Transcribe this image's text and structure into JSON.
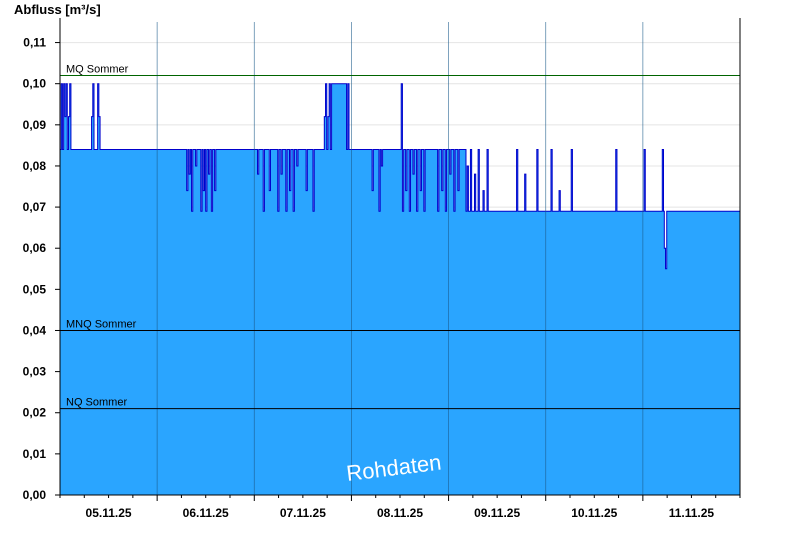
{
  "chart_data": {
    "type": "area",
    "ylabel": "Abfluss [m³/s]",
    "xlabel": "",
    "title": "",
    "ylim": [
      0,
      0.115
    ],
    "xlim": [
      "04.11.25 12:00",
      "11.11.25 12:00"
    ],
    "y_ticks": [
      "0,00",
      "0,01",
      "0,02",
      "0,03",
      "0,04",
      "0,05",
      "0,06",
      "0,07",
      "0,08",
      "0,09",
      "0,10",
      "0,11"
    ],
    "y_tick_values": [
      0,
      0.01,
      0.02,
      0.03,
      0.04,
      0.05,
      0.06,
      0.07,
      0.08,
      0.09,
      0.1,
      0.11
    ],
    "x_ticks": [
      "05.11.25",
      "06.11.25",
      "07.11.25",
      "08.11.25",
      "09.11.25",
      "10.11.25",
      "11.11.25"
    ],
    "x_tick_hours_from_start": [
      12,
      36,
      60,
      84,
      108,
      132,
      156
    ],
    "day_boundary_hours_from_start": [
      24,
      48,
      72,
      96,
      120,
      144
    ],
    "reference_lines": [
      {
        "label": "MQ Sommer",
        "value": 0.102,
        "color": "#006400"
      },
      {
        "label": "MNQ Sommer",
        "value": 0.04,
        "color": "#000000"
      },
      {
        "label": "NQ Sommer",
        "value": 0.021,
        "color": "#000000"
      }
    ],
    "fill_color": "#2aa5ff",
    "line_color": "#0000cc",
    "watermark": "Rohdaten",
    "series": [
      {
        "values_h": [
          [
            0,
            0.084
          ],
          [
            0.3,
            0.1
          ],
          [
            0.6,
            0.084
          ],
          [
            0.9,
            0.1
          ],
          [
            1.2,
            0.092
          ],
          [
            1.5,
            0.1
          ],
          [
            1.8,
            0.084
          ],
          [
            2.1,
            0.092
          ],
          [
            2.4,
            0.1
          ],
          [
            2.7,
            0.084
          ],
          [
            3.0,
            0.084
          ],
          [
            7.5,
            0.084
          ],
          [
            7.8,
            0.092
          ],
          [
            8.1,
            0.1
          ],
          [
            8.4,
            0.084
          ],
          [
            9.0,
            0.084
          ],
          [
            9.3,
            0.1
          ],
          [
            9.6,
            0.092
          ],
          [
            9.9,
            0.084
          ],
          [
            31.0,
            0.084
          ],
          [
            31.3,
            0.074
          ],
          [
            31.6,
            0.084
          ],
          [
            31.9,
            0.078
          ],
          [
            32.2,
            0.084
          ],
          [
            32.5,
            0.069
          ],
          [
            32.8,
            0.084
          ],
          [
            33.2,
            0.084
          ],
          [
            33.5,
            0.08
          ],
          [
            33.8,
            0.084
          ],
          [
            34.5,
            0.084
          ],
          [
            34.8,
            0.069
          ],
          [
            35.1,
            0.084
          ],
          [
            35.4,
            0.074
          ],
          [
            35.7,
            0.084
          ],
          [
            36.0,
            0.069
          ],
          [
            36.3,
            0.084
          ],
          [
            36.7,
            0.078
          ],
          [
            37.0,
            0.084
          ],
          [
            37.4,
            0.069
          ],
          [
            37.7,
            0.084
          ],
          [
            38.2,
            0.074
          ],
          [
            38.5,
            0.084
          ],
          [
            48.5,
            0.084
          ],
          [
            48.8,
            0.078
          ],
          [
            49.1,
            0.084
          ],
          [
            49.9,
            0.084
          ],
          [
            50.2,
            0.069
          ],
          [
            50.5,
            0.084
          ],
          [
            51.4,
            0.084
          ],
          [
            51.7,
            0.074
          ],
          [
            52.0,
            0.084
          ],
          [
            53.5,
            0.084
          ],
          [
            53.8,
            0.069
          ],
          [
            54.1,
            0.084
          ],
          [
            54.6,
            0.078
          ],
          [
            54.9,
            0.084
          ],
          [
            55.5,
            0.084
          ],
          [
            55.8,
            0.069
          ],
          [
            56.1,
            0.084
          ],
          [
            56.7,
            0.074
          ],
          [
            57.0,
            0.084
          ],
          [
            57.6,
            0.069
          ],
          [
            57.9,
            0.084
          ],
          [
            58.5,
            0.08
          ],
          [
            58.8,
            0.084
          ],
          [
            60.5,
            0.084
          ],
          [
            60.8,
            0.074
          ],
          [
            61.1,
            0.084
          ],
          [
            62.2,
            0.084
          ],
          [
            62.5,
            0.069
          ],
          [
            62.8,
            0.084
          ],
          [
            65.0,
            0.084
          ],
          [
            65.3,
            0.092
          ],
          [
            65.6,
            0.1
          ],
          [
            65.9,
            0.084
          ],
          [
            66.2,
            0.092
          ],
          [
            66.5,
            0.1
          ],
          [
            66.8,
            0.084
          ],
          [
            67.1,
            0.1
          ],
          [
            70.5,
            0.1
          ],
          [
            70.8,
            0.084
          ],
          [
            71.1,
            0.1
          ],
          [
            71.4,
            0.084
          ],
          [
            71.8,
            0.084
          ],
          [
            76.8,
            0.084
          ],
          [
            77.1,
            0.074
          ],
          [
            77.4,
            0.084
          ],
          [
            78.5,
            0.084
          ],
          [
            78.8,
            0.069
          ],
          [
            79.1,
            0.084
          ],
          [
            79.4,
            0.08
          ],
          [
            79.7,
            0.084
          ],
          [
            84.0,
            0.084
          ],
          [
            84.3,
            0.1
          ],
          [
            84.6,
            0.069
          ],
          [
            84.9,
            0.084
          ],
          [
            85.4,
            0.074
          ],
          [
            85.7,
            0.084
          ],
          [
            86.3,
            0.069
          ],
          [
            86.6,
            0.084
          ],
          [
            87.2,
            0.078
          ],
          [
            87.5,
            0.084
          ],
          [
            88.1,
            0.069
          ],
          [
            88.4,
            0.084
          ],
          [
            89.0,
            0.074
          ],
          [
            89.3,
            0.084
          ],
          [
            89.9,
            0.069
          ],
          [
            90.2,
            0.084
          ],
          [
            93.0,
            0.084
          ],
          [
            93.3,
            0.069
          ],
          [
            93.6,
            0.084
          ],
          [
            94.3,
            0.074
          ],
          [
            94.6,
            0.084
          ],
          [
            95.2,
            0.069
          ],
          [
            95.5,
            0.084
          ],
          [
            96.3,
            0.078
          ],
          [
            96.6,
            0.084
          ],
          [
            97.3,
            0.069
          ],
          [
            97.6,
            0.084
          ],
          [
            98.3,
            0.074
          ],
          [
            98.6,
            0.084
          ],
          [
            100.0,
            0.084
          ],
          [
            100.3,
            0.069
          ],
          [
            100.6,
            0.08
          ],
          [
            100.9,
            0.069
          ],
          [
            101.4,
            0.084
          ],
          [
            101.7,
            0.069
          ],
          [
            102.4,
            0.078
          ],
          [
            102.7,
            0.069
          ],
          [
            103.3,
            0.084
          ],
          [
            103.6,
            0.069
          ],
          [
            104.5,
            0.074
          ],
          [
            104.8,
            0.069
          ],
          [
            105.5,
            0.084
          ],
          [
            105.8,
            0.069
          ],
          [
            112.5,
            0.069
          ],
          [
            112.8,
            0.084
          ],
          [
            113.1,
            0.069
          ],
          [
            114.5,
            0.069
          ],
          [
            114.8,
            0.078
          ],
          [
            115.1,
            0.069
          ],
          [
            117.5,
            0.069
          ],
          [
            117.8,
            0.084
          ],
          [
            118.1,
            0.069
          ],
          [
            121.0,
            0.069
          ],
          [
            121.3,
            0.084
          ],
          [
            121.6,
            0.069
          ],
          [
            123.0,
            0.069
          ],
          [
            123.3,
            0.074
          ],
          [
            123.6,
            0.069
          ],
          [
            126.0,
            0.069
          ],
          [
            126.3,
            0.084
          ],
          [
            126.6,
            0.069
          ],
          [
            137.0,
            0.069
          ],
          [
            137.3,
            0.084
          ],
          [
            137.6,
            0.069
          ],
          [
            144.0,
            0.069
          ],
          [
            144.3,
            0.084
          ],
          [
            144.6,
            0.069
          ],
          [
            148.5,
            0.069
          ],
          [
            148.8,
            0.084
          ],
          [
            149.1,
            0.069
          ],
          [
            149.3,
            0.06
          ],
          [
            149.6,
            0.055
          ],
          [
            149.9,
            0.069
          ],
          [
            168,
            0.069
          ]
        ]
      }
    ]
  }
}
